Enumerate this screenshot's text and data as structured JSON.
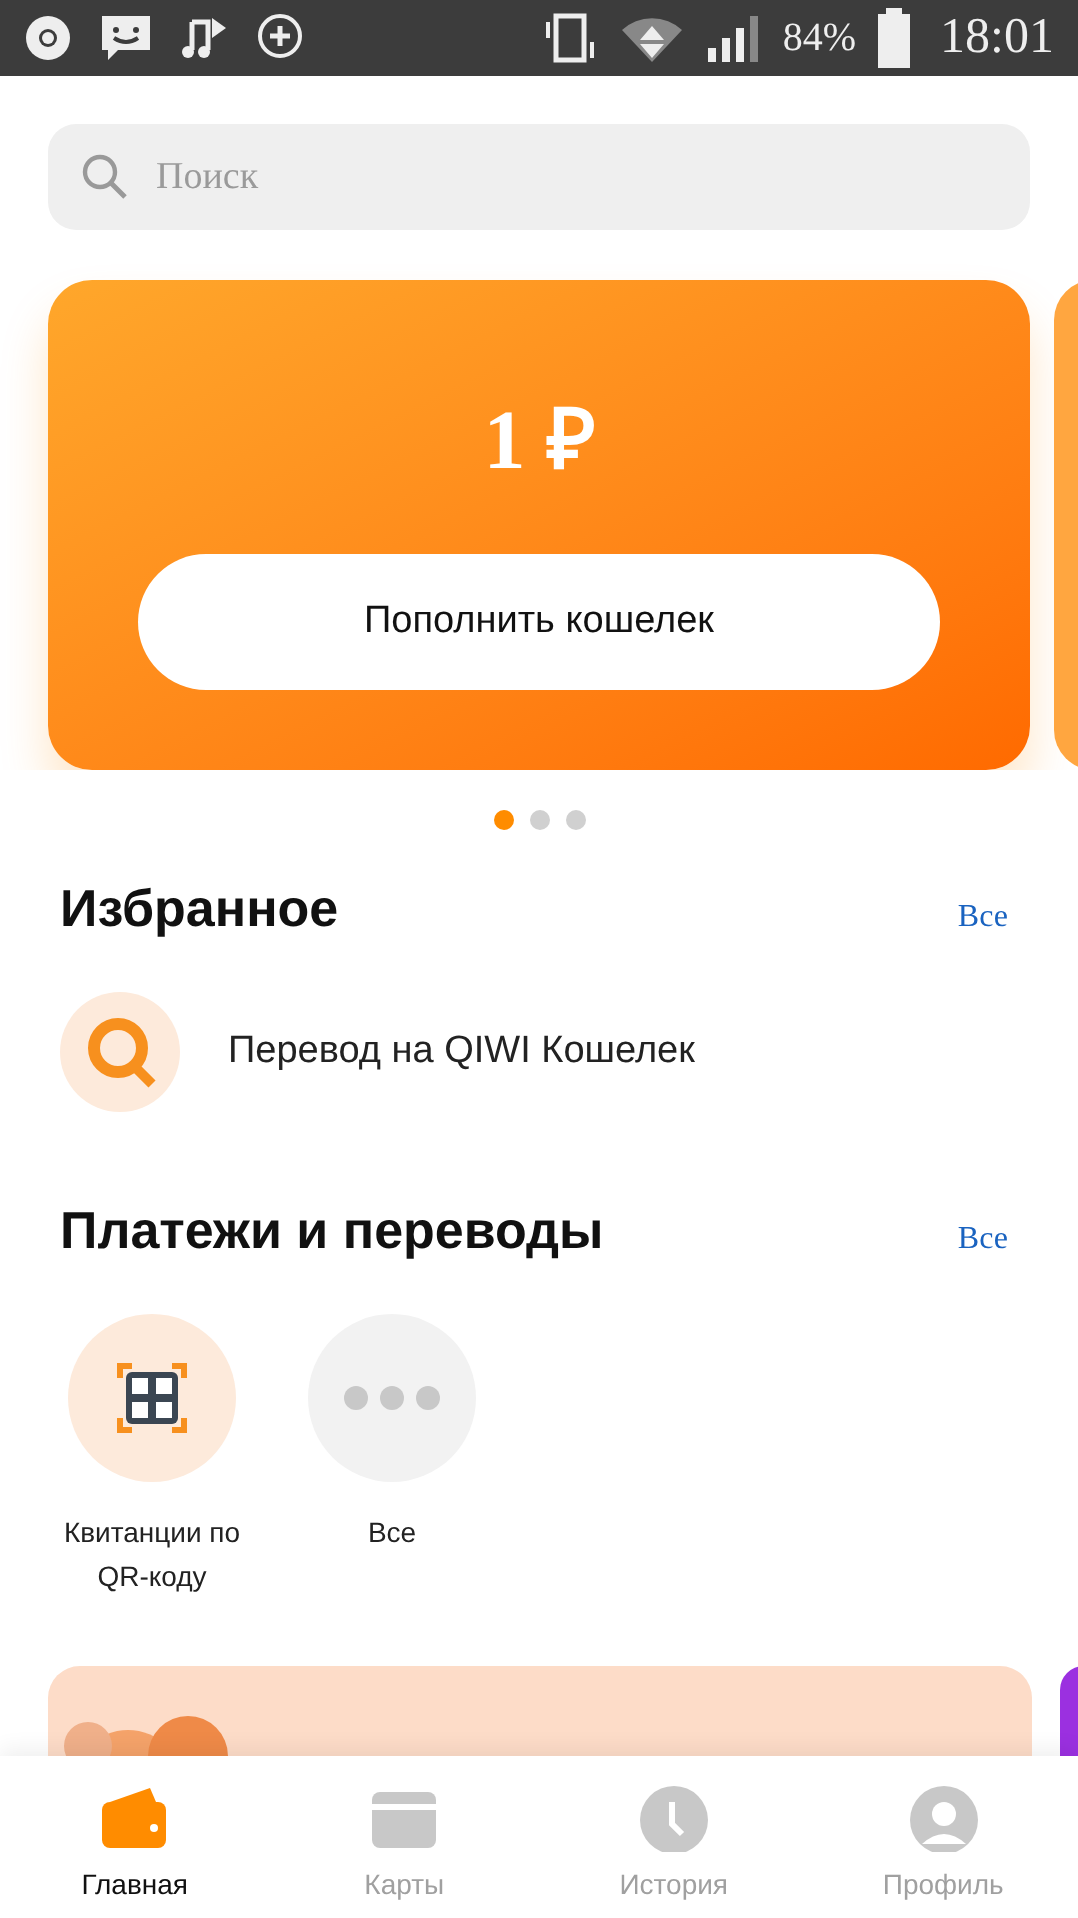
{
  "status_bar": {
    "battery": "84%",
    "time": "18:01"
  },
  "search": {
    "placeholder": "Поиск"
  },
  "balance_card": {
    "amount": "1 ₽",
    "button": "Пополнить кошелек"
  },
  "carousel_dots": [
    {
      "selected": true
    },
    {
      "selected": false
    },
    {
      "selected": false
    }
  ],
  "favorites": {
    "title": "Избранное",
    "all_link": "Все",
    "items": [
      {
        "label": "Перевод на QIWI Кошелек"
      }
    ]
  },
  "payments": {
    "title": "Платежи и переводы",
    "all_link": "Все",
    "tiles": [
      {
        "kind": "qr",
        "label": "Квитанции по QR-коду"
      },
      {
        "kind": "more",
        "label": "Все"
      }
    ]
  },
  "bottom_nav": [
    {
      "kind": "wallet",
      "label": "Главная",
      "selected": true
    },
    {
      "kind": "card",
      "label": "Карты",
      "selected": false
    },
    {
      "kind": "history",
      "label": "История",
      "selected": false
    },
    {
      "kind": "profile",
      "label": "Профиль",
      "selected": false
    }
  ]
}
